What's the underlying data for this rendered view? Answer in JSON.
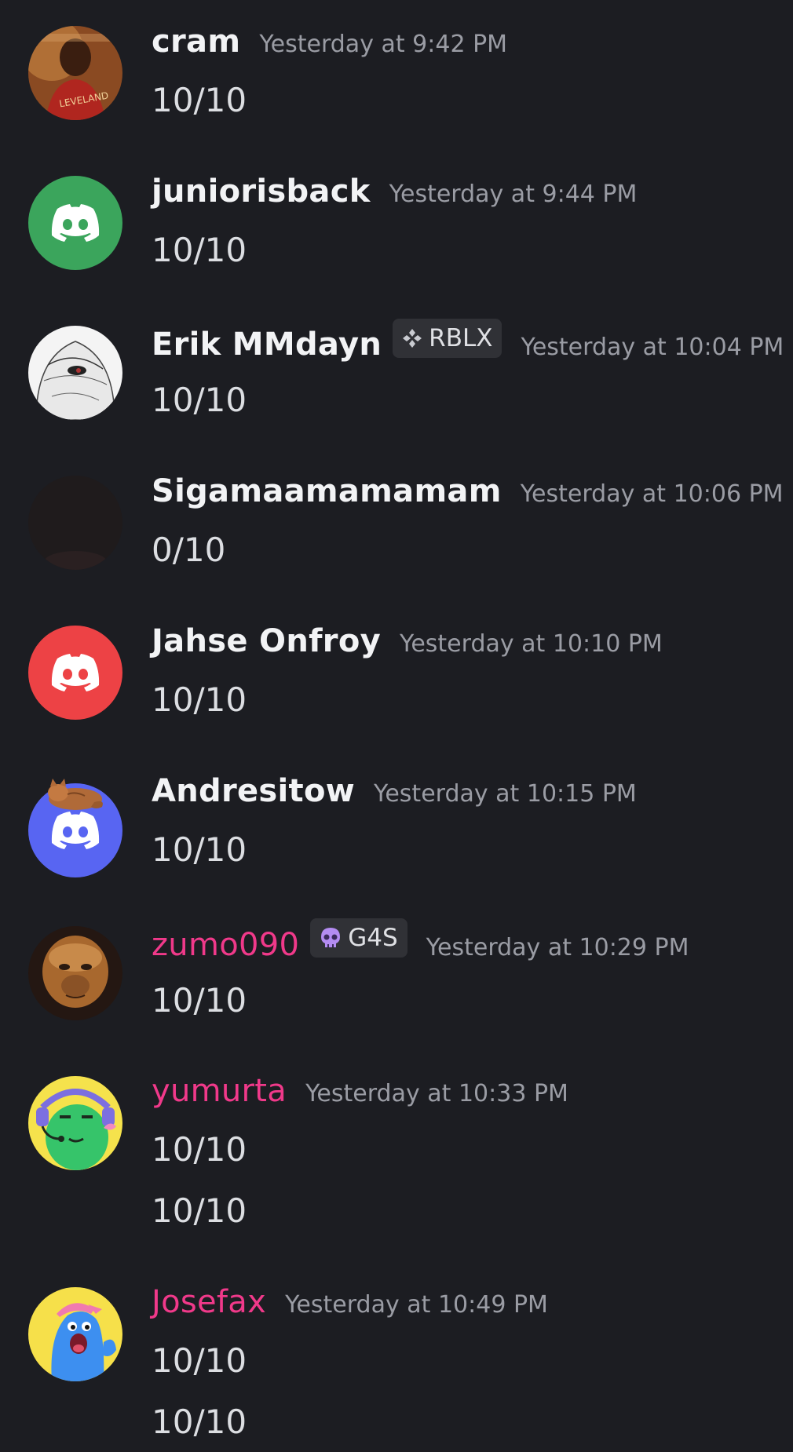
{
  "messages": [
    {
      "name": "cram",
      "timestamp": "Yesterday at 9:42 PM",
      "lines": [
        "10/10"
      ],
      "avatar": "photo-basketball-player",
      "name_color": "#f2f3f5"
    },
    {
      "name": "juniorisback",
      "timestamp": "Yesterday at 9:44 PM",
      "lines": [
        "10/10"
      ],
      "avatar": "discord-default-green",
      "name_color": "#f2f3f5"
    },
    {
      "name": "Erik MMdayn",
      "tag": "RBLX",
      "tag_icon": "four-diamond-icon",
      "timestamp": "Yesterday at 10:04 PM",
      "lines": [
        "10/10"
      ],
      "avatar": "sketch-hooded-figure",
      "name_color": "#f2f3f5"
    },
    {
      "name": "Sigamaamamamam",
      "timestamp": "Yesterday at 10:06 PM",
      "lines": [
        "0/10"
      ],
      "avatar": "dark-photo",
      "name_color": "#f2f3f5"
    },
    {
      "name": "Jahse Onfroy",
      "timestamp": "Yesterday at 10:10 PM",
      "lines": [
        "10/10"
      ],
      "avatar": "discord-default-red",
      "name_color": "#f2f3f5"
    },
    {
      "name": "Andresitow",
      "timestamp": "Yesterday at 10:15 PM",
      "lines": [
        "10/10"
      ],
      "avatar": "discord-default-blurple-cat-decoration",
      "name_color": "#f2f3f5"
    },
    {
      "name": "zumo090",
      "tag": "G4S",
      "tag_icon": "skull-icon",
      "timestamp": "Yesterday at 10:29 PM",
      "lines": [
        "10/10"
      ],
      "avatar": "photo-ape",
      "name_color": "#f0398a"
    },
    {
      "name": "yumurta",
      "timestamp": "Yesterday at 10:33 PM",
      "lines": [
        "10/10",
        "10/10"
      ],
      "avatar": "cartoon-green-gamer",
      "name_color": "#f0398a"
    },
    {
      "name": "Josefax",
      "timestamp": "Yesterday at 10:49 PM",
      "lines": [
        "10/10",
        "10/10"
      ],
      "avatar": "cartoon-blue-creature",
      "name_color": "#f0398a"
    }
  ],
  "colors": {
    "background": "#1c1d22",
    "discord_green": "#3ba55c",
    "discord_red": "#ed4245",
    "discord_blurple": "#5865f2",
    "role_pink": "#f0398a"
  }
}
